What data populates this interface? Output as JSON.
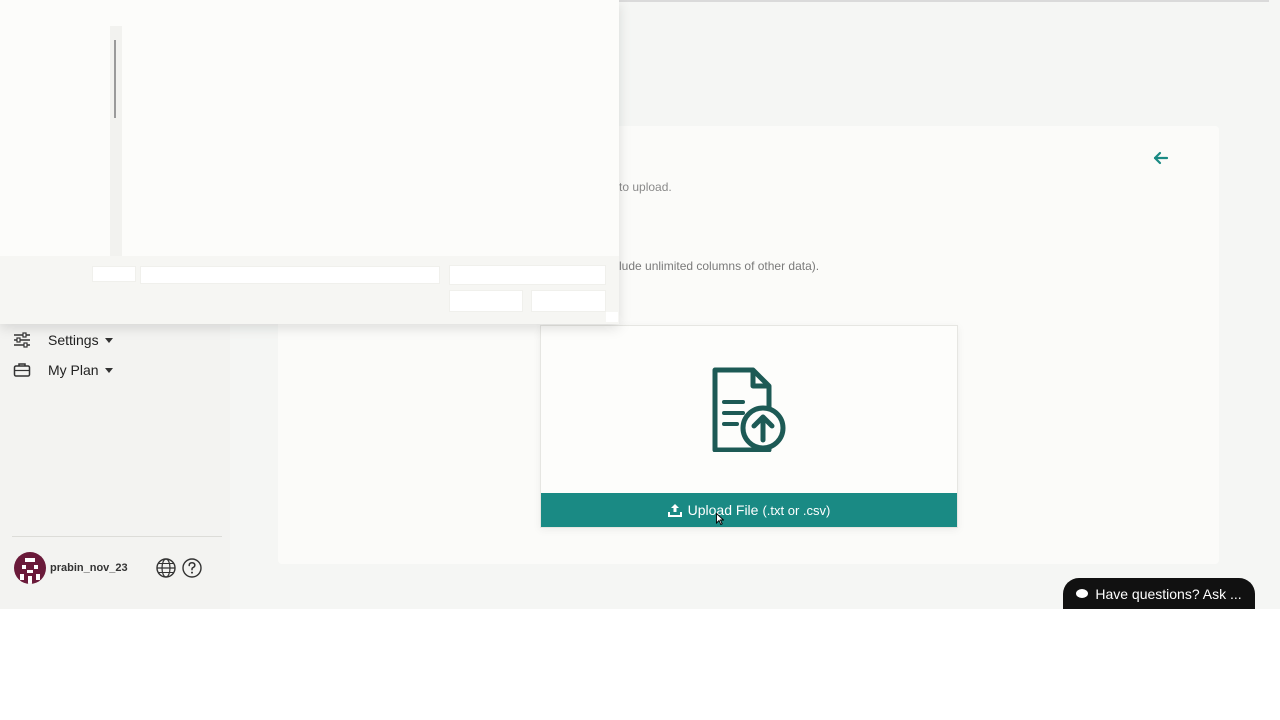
{
  "sidebar": {
    "items": [
      {
        "label": "Settings",
        "icon": "sliders-icon"
      },
      {
        "label": "My Plan",
        "icon": "briefcase-icon"
      }
    ],
    "user": {
      "name": "prabin_nov_23"
    },
    "utility_icons": [
      "globe-icon",
      "help-icon"
    ]
  },
  "main": {
    "fragment_1": "to upload.",
    "fragment_2": "lude unlimited columns of other data).",
    "upload": {
      "icon": "document-upload-icon",
      "button_label": "Upload File",
      "button_hint": "(.txt or .csv)",
      "button_icon": "upload-icon"
    }
  },
  "chat": {
    "label": "Have questions? Ask ...",
    "icon": "chat-bubble-icon"
  },
  "colors": {
    "accent": "#1a8a84",
    "pill_bg": "#111111",
    "sidebar_bg": "#f3f3f1"
  }
}
